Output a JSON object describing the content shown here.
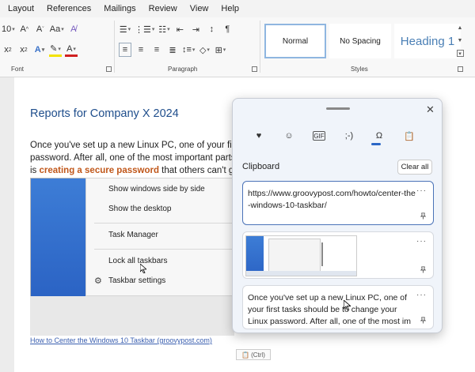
{
  "menubar": {
    "items": [
      "Layout",
      "References",
      "Mailings",
      "Review",
      "View",
      "Help"
    ]
  },
  "ribbon": {
    "font_size_fragment": "10",
    "groups": {
      "font": "Font",
      "paragraph": "Paragraph",
      "styles": "Styles"
    },
    "styles": [
      "Normal",
      "No Spacing",
      "Heading 1"
    ]
  },
  "document": {
    "title": "Reports for Company X 2024",
    "para_line1": "Once you've set up a new Linux PC, one of your first",
    "para_line2": "password. After all, one of the most important parts of",
    "para_line3_pre": "is ",
    "para_line3_link": "creating a secure password",
    "para_line3_post": " that others can't gue",
    "context_menu": [
      "Show windows side by side",
      "Show the desktop",
      "Task Manager",
      "Lock all taskbars",
      "Taskbar settings"
    ],
    "link": "How to Center the Windows 10 Taskbar (groovypost.com)",
    "paste_label": "(Ctrl)"
  },
  "clipboard": {
    "title": "Clipboard",
    "clear_all": "Clear all",
    "tab_icons": [
      "sticker-icon",
      "emoji-icon",
      "gif-icon",
      "kaomoji-icon",
      "symbols-icon",
      "clipboard-icon"
    ],
    "tab_glyphs": [
      "♥",
      "☺",
      "GIF",
      ";-)",
      "Ω",
      "📋"
    ],
    "items": [
      {
        "text": "https://www.groovypost.com/howto/center-the-windows-10-taskbar/"
      },
      {
        "text": ""
      },
      {
        "text": "Once you've set up a new Linux PC, one of your first tasks should be to change your Linux password. After all, one of the most im"
      }
    ],
    "more_label": "···"
  }
}
